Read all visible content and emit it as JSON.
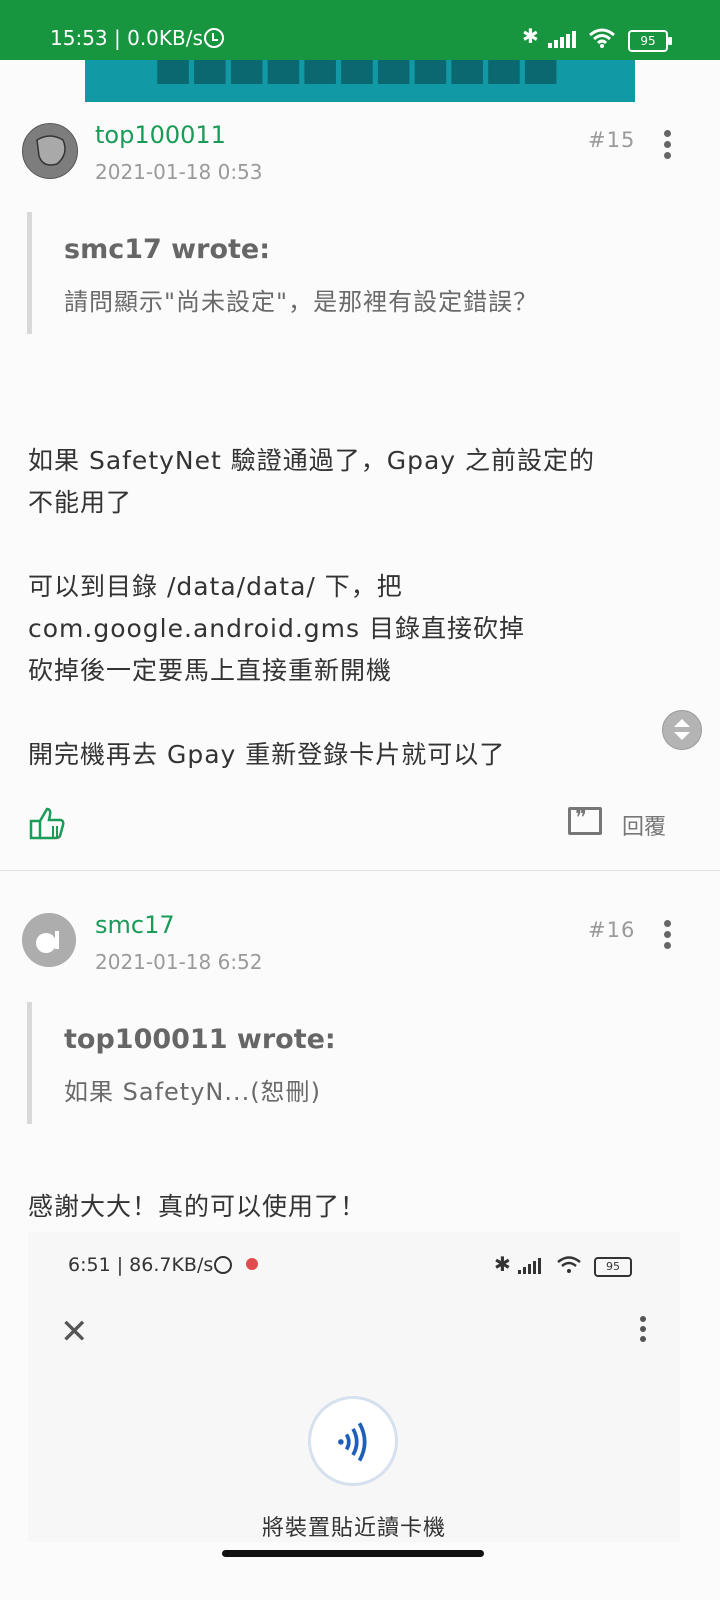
{
  "status_bar": {
    "time": "15:53 | 0.0KB/s",
    "battery": "95"
  },
  "posts": [
    {
      "author": "top100011",
      "date": "2021-01-18 0:53",
      "number": "#15",
      "quote_author": "smc17 wrote:",
      "quote_text": "請問顯示\"尚未設定\"，是那裡有設定錯誤？",
      "body": [
        "如果 SafetyNet 驗證通過了，Gpay 之前設定的",
        "不能用了",
        "",
        "可以到目錄 /data/data/ 下，把",
        "com.google.android.gms 目錄直接砍掉",
        "砍掉後一定要馬上直接重新開機",
        "",
        "開完機再去 Gpay 重新登錄卡片就可以了"
      ],
      "reply_label": "回覆"
    },
    {
      "author": "smc17",
      "date": "2021-01-18 6:52",
      "number": "#16",
      "quote_author": "top100011 wrote:",
      "quote_text": "如果 SafetyN...(恕刪)",
      "body": [
        "感謝大大！真的可以使用了！"
      ]
    }
  ],
  "embedded_screenshot": {
    "time": "6:51 | 86.7KB/s",
    "battery": "95",
    "label": "將裝置貼近讀卡機"
  }
}
